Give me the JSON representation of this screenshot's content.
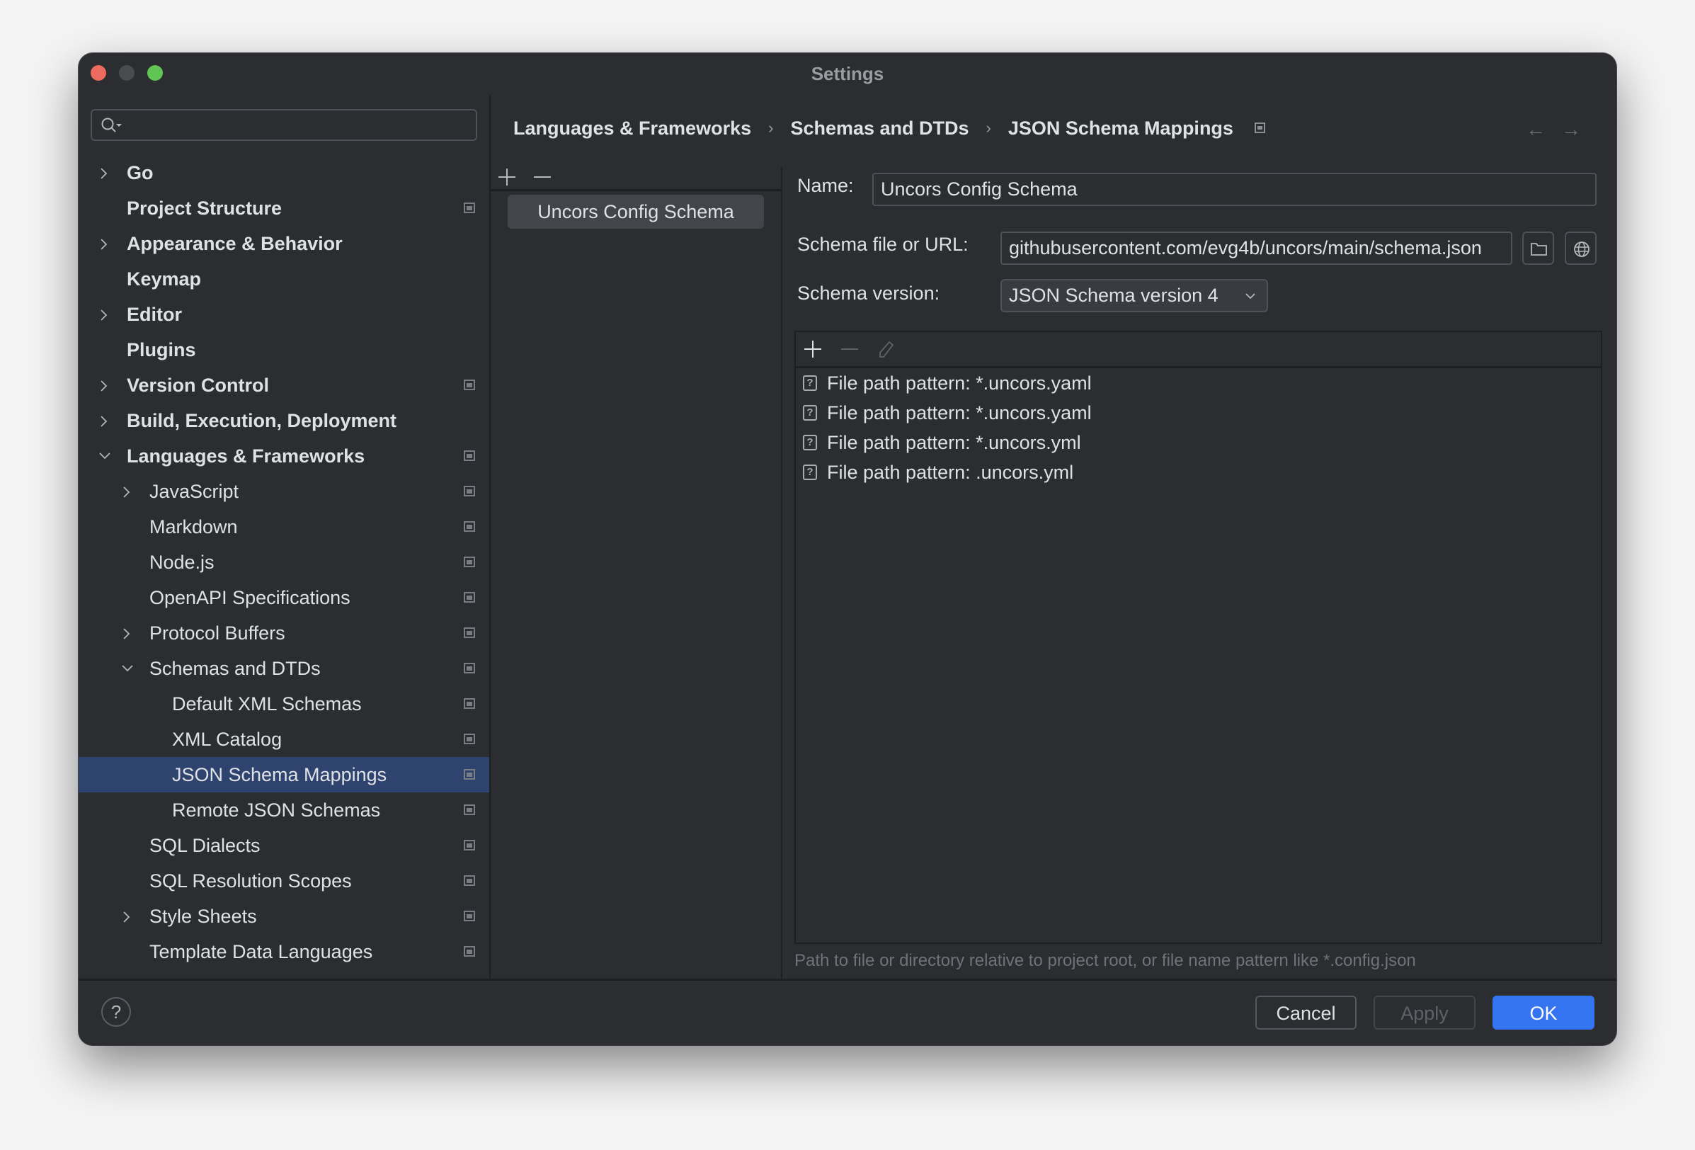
{
  "window": {
    "title": "Settings"
  },
  "search": {
    "placeholder": "",
    "value": ""
  },
  "sidebar": {
    "items": [
      {
        "label": "Go",
        "level": 0,
        "bold": true,
        "chevron": "right",
        "project_icon": false
      },
      {
        "label": "Project Structure",
        "level": 0,
        "bold": true,
        "chevron": "none",
        "project_icon": true
      },
      {
        "label": "Appearance & Behavior",
        "level": 0,
        "bold": true,
        "chevron": "right",
        "project_icon": false
      },
      {
        "label": "Keymap",
        "level": 0,
        "bold": true,
        "chevron": "none",
        "project_icon": false
      },
      {
        "label": "Editor",
        "level": 0,
        "bold": true,
        "chevron": "right",
        "project_icon": false
      },
      {
        "label": "Plugins",
        "level": 0,
        "bold": true,
        "chevron": "none",
        "project_icon": false
      },
      {
        "label": "Version Control",
        "level": 0,
        "bold": true,
        "chevron": "right",
        "project_icon": true
      },
      {
        "label": "Build, Execution, Deployment",
        "level": 0,
        "bold": true,
        "chevron": "right",
        "project_icon": false
      },
      {
        "label": "Languages & Frameworks",
        "level": 0,
        "bold": true,
        "chevron": "down",
        "project_icon": true
      },
      {
        "label": "JavaScript",
        "level": 1,
        "bold": false,
        "chevron": "right",
        "project_icon": true
      },
      {
        "label": "Markdown",
        "level": 1,
        "bold": false,
        "chevron": "none",
        "project_icon": true
      },
      {
        "label": "Node.js",
        "level": 1,
        "bold": false,
        "chevron": "none",
        "project_icon": true
      },
      {
        "label": "OpenAPI Specifications",
        "level": 1,
        "bold": false,
        "chevron": "none",
        "project_icon": true
      },
      {
        "label": "Protocol Buffers",
        "level": 1,
        "bold": false,
        "chevron": "right",
        "project_icon": true
      },
      {
        "label": "Schemas and DTDs",
        "level": 1,
        "bold": false,
        "chevron": "down",
        "project_icon": true
      },
      {
        "label": "Default XML Schemas",
        "level": 2,
        "bold": false,
        "chevron": "none",
        "project_icon": true
      },
      {
        "label": "XML Catalog",
        "level": 2,
        "bold": false,
        "chevron": "none",
        "project_icon": true
      },
      {
        "label": "JSON Schema Mappings",
        "level": 2,
        "bold": false,
        "chevron": "none",
        "project_icon": true,
        "selected": true
      },
      {
        "label": "Remote JSON Schemas",
        "level": 2,
        "bold": false,
        "chevron": "none",
        "project_icon": true
      },
      {
        "label": "SQL Dialects",
        "level": 1,
        "bold": false,
        "chevron": "none",
        "project_icon": true
      },
      {
        "label": "SQL Resolution Scopes",
        "level": 1,
        "bold": false,
        "chevron": "none",
        "project_icon": true
      },
      {
        "label": "Style Sheets",
        "level": 1,
        "bold": false,
        "chevron": "right",
        "project_icon": true
      },
      {
        "label": "Template Data Languages",
        "level": 1,
        "bold": false,
        "chevron": "none",
        "project_icon": true
      }
    ]
  },
  "breadcrumb": {
    "items": [
      "Languages & Frameworks",
      "Schemas and DTDs",
      "JSON Schema Mappings"
    ],
    "separator": "›",
    "back_icon": "arrow-left-icon",
    "forward_icon": "arrow-right-icon"
  },
  "mappings": {
    "toolbar": {
      "add": "add-icon",
      "remove": "remove-icon"
    },
    "items": [
      "Uncors Config Schema"
    ],
    "selected_index": 0
  },
  "form": {
    "name_label": "Name:",
    "name_value": "Uncors Config Schema",
    "url_label": "Schema file or URL:",
    "url_value": "githubusercontent.com/evg4b/uncors/main/schema.json",
    "browse_icon": "folder-icon",
    "web_icon": "globe-icon",
    "version_label": "Schema version:",
    "version_value": "JSON Schema version 4"
  },
  "patterns": {
    "toolbar": {
      "add": "add-icon",
      "remove": "remove-icon",
      "edit": "edit-icon"
    },
    "rows": [
      "File path pattern: *.uncors.yaml",
      "File path pattern: *.uncors.yaml",
      "File path pattern: *.uncors.yml",
      "File path pattern: .uncors.yml"
    ],
    "row_icon": "?",
    "hint": "Path to file or directory relative to project root, or file name pattern like *.config.json"
  },
  "footer": {
    "help": "?",
    "cancel": "Cancel",
    "apply": "Apply",
    "ok": "OK"
  },
  "colors": {
    "background": "#2b2d30",
    "selection": "#2e436e",
    "accent": "#3574f0",
    "close": "#ed6a5e",
    "zoom": "#61c554"
  }
}
